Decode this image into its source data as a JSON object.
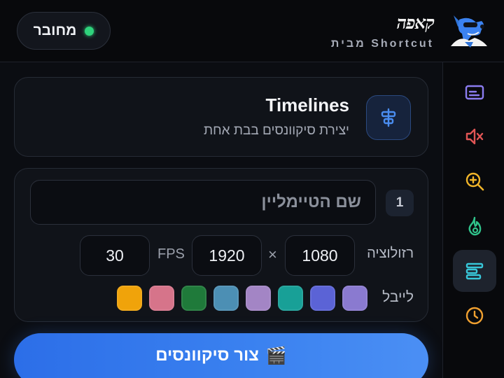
{
  "header": {
    "status_label": "מחובר",
    "status_color": "#2fd37c",
    "brand_logo": "קאפה",
    "brand_subtitle": "מבית Shortcut",
    "mascot_icon": "dog-mascot-icon"
  },
  "sidebar": {
    "items": [
      {
        "icon": "subtitles-icon",
        "color": "#8b7cf0",
        "active": false
      },
      {
        "icon": "mute-icon",
        "color": "#e05555",
        "active": false
      },
      {
        "icon": "zoom-in-icon",
        "color": "#f0b429",
        "active": false
      },
      {
        "icon": "flame-icon",
        "color": "#2fc28a",
        "active": false
      },
      {
        "icon": "timeline-icon",
        "color": "#38c7d9",
        "active": true
      },
      {
        "icon": "clock-icon",
        "color": "#f0a030",
        "active": false
      }
    ]
  },
  "panel": {
    "title": "Timelines",
    "subtitle": "יצירת סיקוונסים בבת אחת",
    "icon": "align-center-icon"
  },
  "form": {
    "index": "1",
    "name_value": "",
    "name_placeholder": "שם הטיימליין",
    "resolution_label": "רזולוציה",
    "width": "1080",
    "times": "×",
    "height": "1920",
    "fps_label": "FPS",
    "fps": "30",
    "label_title": "לייבל",
    "label_colors": [
      "#8a7ad0",
      "#5b63d6",
      "#18a097",
      "#a385c5",
      "#4c8fb4",
      "#1f7a3a",
      "#d6748a",
      "#f0a30a"
    ]
  },
  "action": {
    "emoji": "🎬",
    "label": "צור סיקוונסים"
  }
}
